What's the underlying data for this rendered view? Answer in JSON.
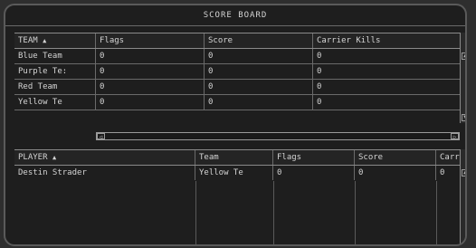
{
  "title": "SCORE BOARD",
  "team_table": {
    "headers": [
      "TEAM",
      "Flags",
      "Score",
      "Carrier Kills"
    ],
    "rows": [
      [
        "Blue Team",
        "0",
        "0",
        "0"
      ],
      [
        "Purple Te:",
        "0",
        "0",
        "0"
      ],
      [
        "Red Team",
        "0",
        "0",
        "0"
      ],
      [
        "Yellow Te",
        "0",
        "0",
        "0"
      ]
    ]
  },
  "player_table": {
    "headers": [
      "PLAYER",
      "Team",
      "Flags",
      "Score",
      "Carr"
    ],
    "rows": [
      [
        "Destin Strader",
        "Yellow Te",
        "0",
        "0",
        "0"
      ]
    ]
  },
  "icons": {
    "sort": "▲",
    "left": "◁",
    "right": "▷",
    "up": "▲",
    "down": "▼"
  }
}
